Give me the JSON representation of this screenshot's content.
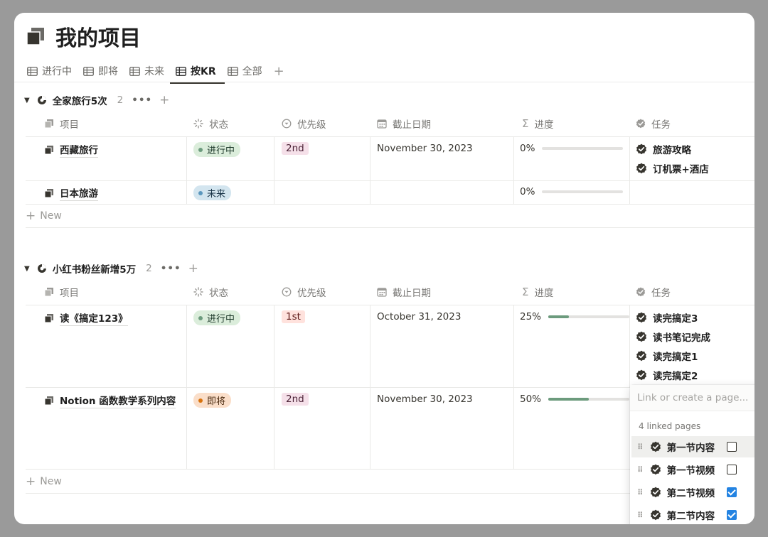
{
  "page": {
    "title": "我的项目"
  },
  "tabs": [
    {
      "label": "进行中",
      "active": false
    },
    {
      "label": "即将",
      "active": false
    },
    {
      "label": "未来",
      "active": false
    },
    {
      "label": "按KR",
      "active": true
    },
    {
      "label": "全部",
      "active": false
    }
  ],
  "tab_add": "+",
  "columns": {
    "name": "项目",
    "status": "状态",
    "priority": "优先级",
    "due": "截止日期",
    "progress": "进度",
    "tasks": "任务"
  },
  "groups": [
    {
      "name": "全家旅行5次",
      "count": "2",
      "more": "•••",
      "add": "+",
      "rows": [
        {
          "name": "西藏旅行",
          "status": "进行中",
          "status_type": "green",
          "priority": "2nd",
          "priority_type": "pink",
          "due": "November 30, 2023",
          "progress_label": "0%",
          "progress": 0,
          "tasks": [
            "旅游攻略",
            "订机票+酒店"
          ]
        },
        {
          "name": "日本旅游",
          "status": "未来",
          "status_type": "blue",
          "priority": "",
          "priority_type": "",
          "due": "",
          "progress_label": "0%",
          "progress": 0,
          "tasks": []
        }
      ],
      "new_label": "New"
    },
    {
      "name": "小红书粉丝新增5万",
      "count": "2",
      "more": "•••",
      "add": "+",
      "rows": [
        {
          "name": "读《搞定123》",
          "status": "进行中",
          "status_type": "green",
          "priority": "1st",
          "priority_type": "red",
          "due": "October 31, 2023",
          "progress_label": "25%",
          "progress": 0.25,
          "tasks": [
            "读完搞定3",
            "读书笔记完成",
            "读完搞定1",
            "读完搞定2"
          ]
        },
        {
          "name": "Notion 函数教学系列内容",
          "status": "即将",
          "status_type": "orange",
          "priority": "2nd",
          "priority_type": "pink",
          "due": "November 30, 2023",
          "progress_label": "50%",
          "progress": 0.5,
          "tasks": []
        }
      ],
      "new_label": "New"
    }
  ],
  "popup": {
    "placeholder": "Link or create a page...",
    "linked_label": "4 linked pages",
    "items": [
      {
        "label": "第一节内容",
        "checked": false
      },
      {
        "label": "第一节视频",
        "checked": false
      },
      {
        "label": "第二节视频",
        "checked": true
      },
      {
        "label": "第二节内容",
        "checked": true
      }
    ]
  },
  "colors": {
    "green_bg": "#dbeddb",
    "green_dot": "#6c9b7d",
    "blue_bg": "#d3e5ef",
    "blue_dot": "#5b97bd",
    "orange_bg": "#fadec9",
    "orange_dot": "#d9730d",
    "pink_bg": "#f5e0e9",
    "red_bg": "#ffe2dd",
    "checkbox_on": "#2383e2"
  }
}
